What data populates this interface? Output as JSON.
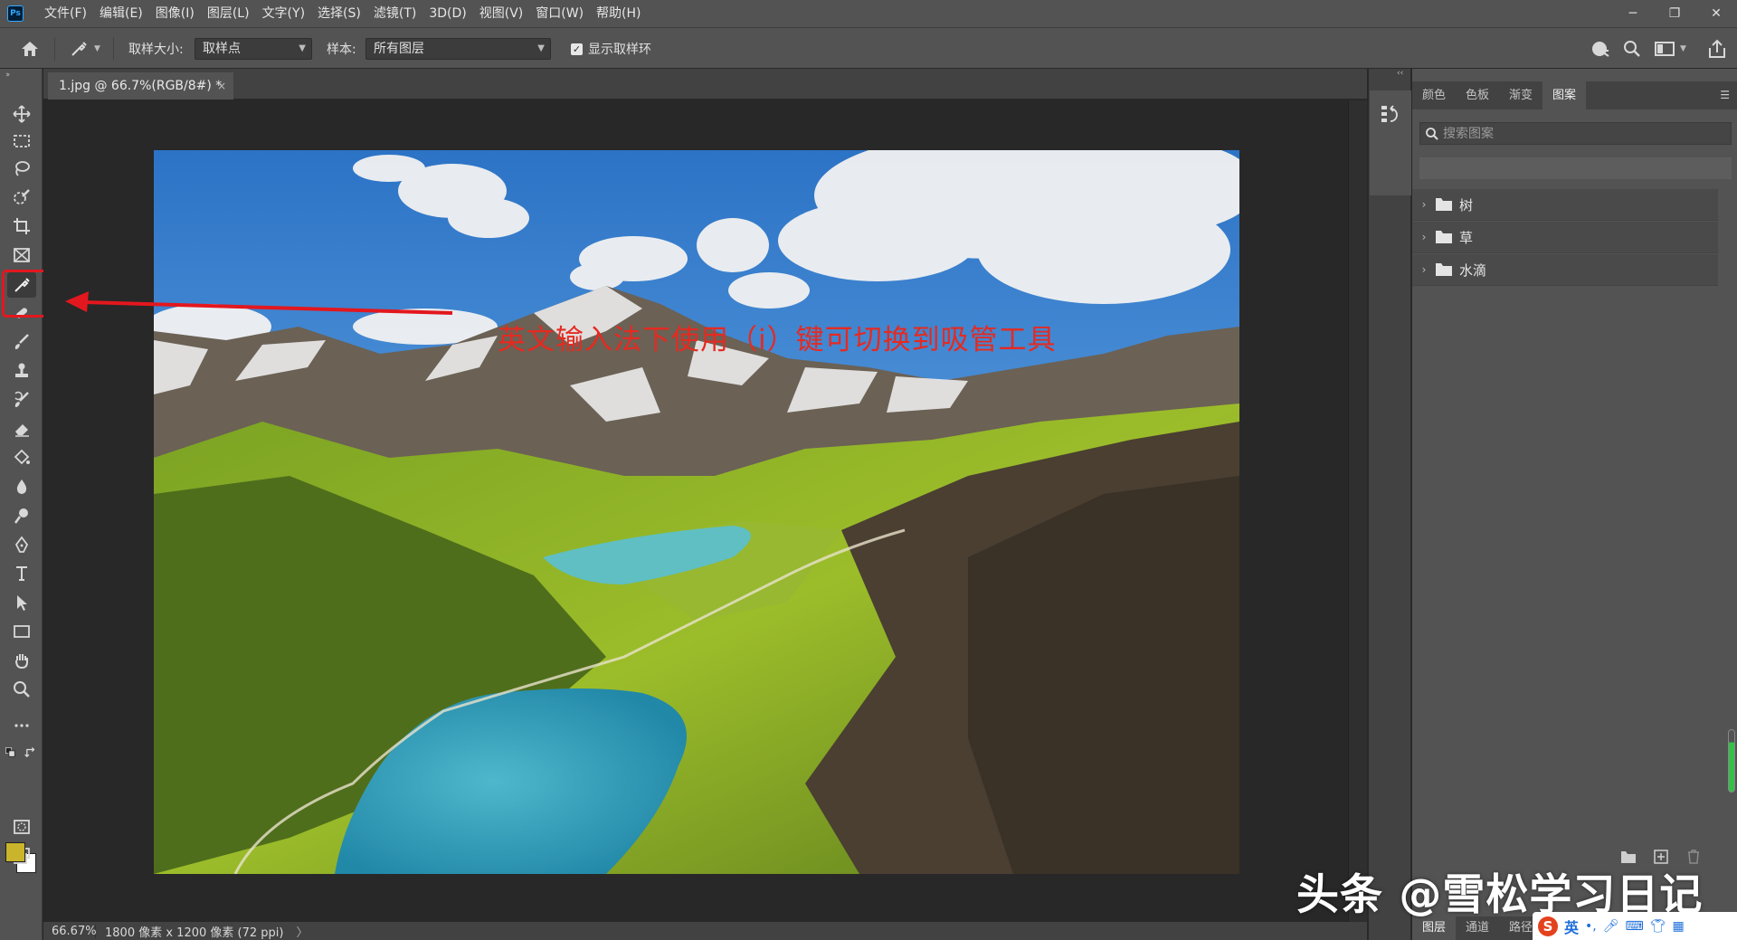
{
  "app": {
    "logo": "Ps",
    "accent": "#31a8ff"
  },
  "menu": [
    "文件(F)",
    "编辑(E)",
    "图像(I)",
    "图层(L)",
    "文字(Y)",
    "选择(S)",
    "滤镜(T)",
    "3D(D)",
    "视图(V)",
    "窗口(W)",
    "帮助(H)"
  ],
  "options": {
    "sample_size_label": "取样大小:",
    "sample_size_value": "取样点",
    "sample_label": "样本:",
    "sample_value": "所有图层",
    "show_ring_label": "显示取样环",
    "show_ring_checked": true
  },
  "document": {
    "tab_title": "1.jpg @ 66.7%(RGB/8#) *",
    "tab_close": "×"
  },
  "annotation": {
    "text": "英文输入法下使用（i）键可切换到吸管工具",
    "color": "#e52a21"
  },
  "status": {
    "zoom": "66.67%",
    "info": "1800 像素 x 1200 像素 (72 ppi)",
    "arrow": "〉"
  },
  "panel": {
    "tabs": [
      "颜色",
      "色板",
      "渐变",
      "图案"
    ],
    "active_tab": "图案",
    "search_placeholder": "搜索图案",
    "folders": [
      "树",
      "草",
      "水滴"
    ]
  },
  "layers_panel": {
    "tabs": [
      "图层",
      "通道",
      "路径"
    ],
    "active_tab": "图层"
  },
  "colors": {
    "foreground": "#c9b42c",
    "background": "#ffffff"
  },
  "ime": {
    "lang": "英",
    "punct": "•,"
  },
  "watermark": "头条 @雪松学习日记",
  "window_controls": [
    "─",
    "❐",
    "✕"
  ]
}
